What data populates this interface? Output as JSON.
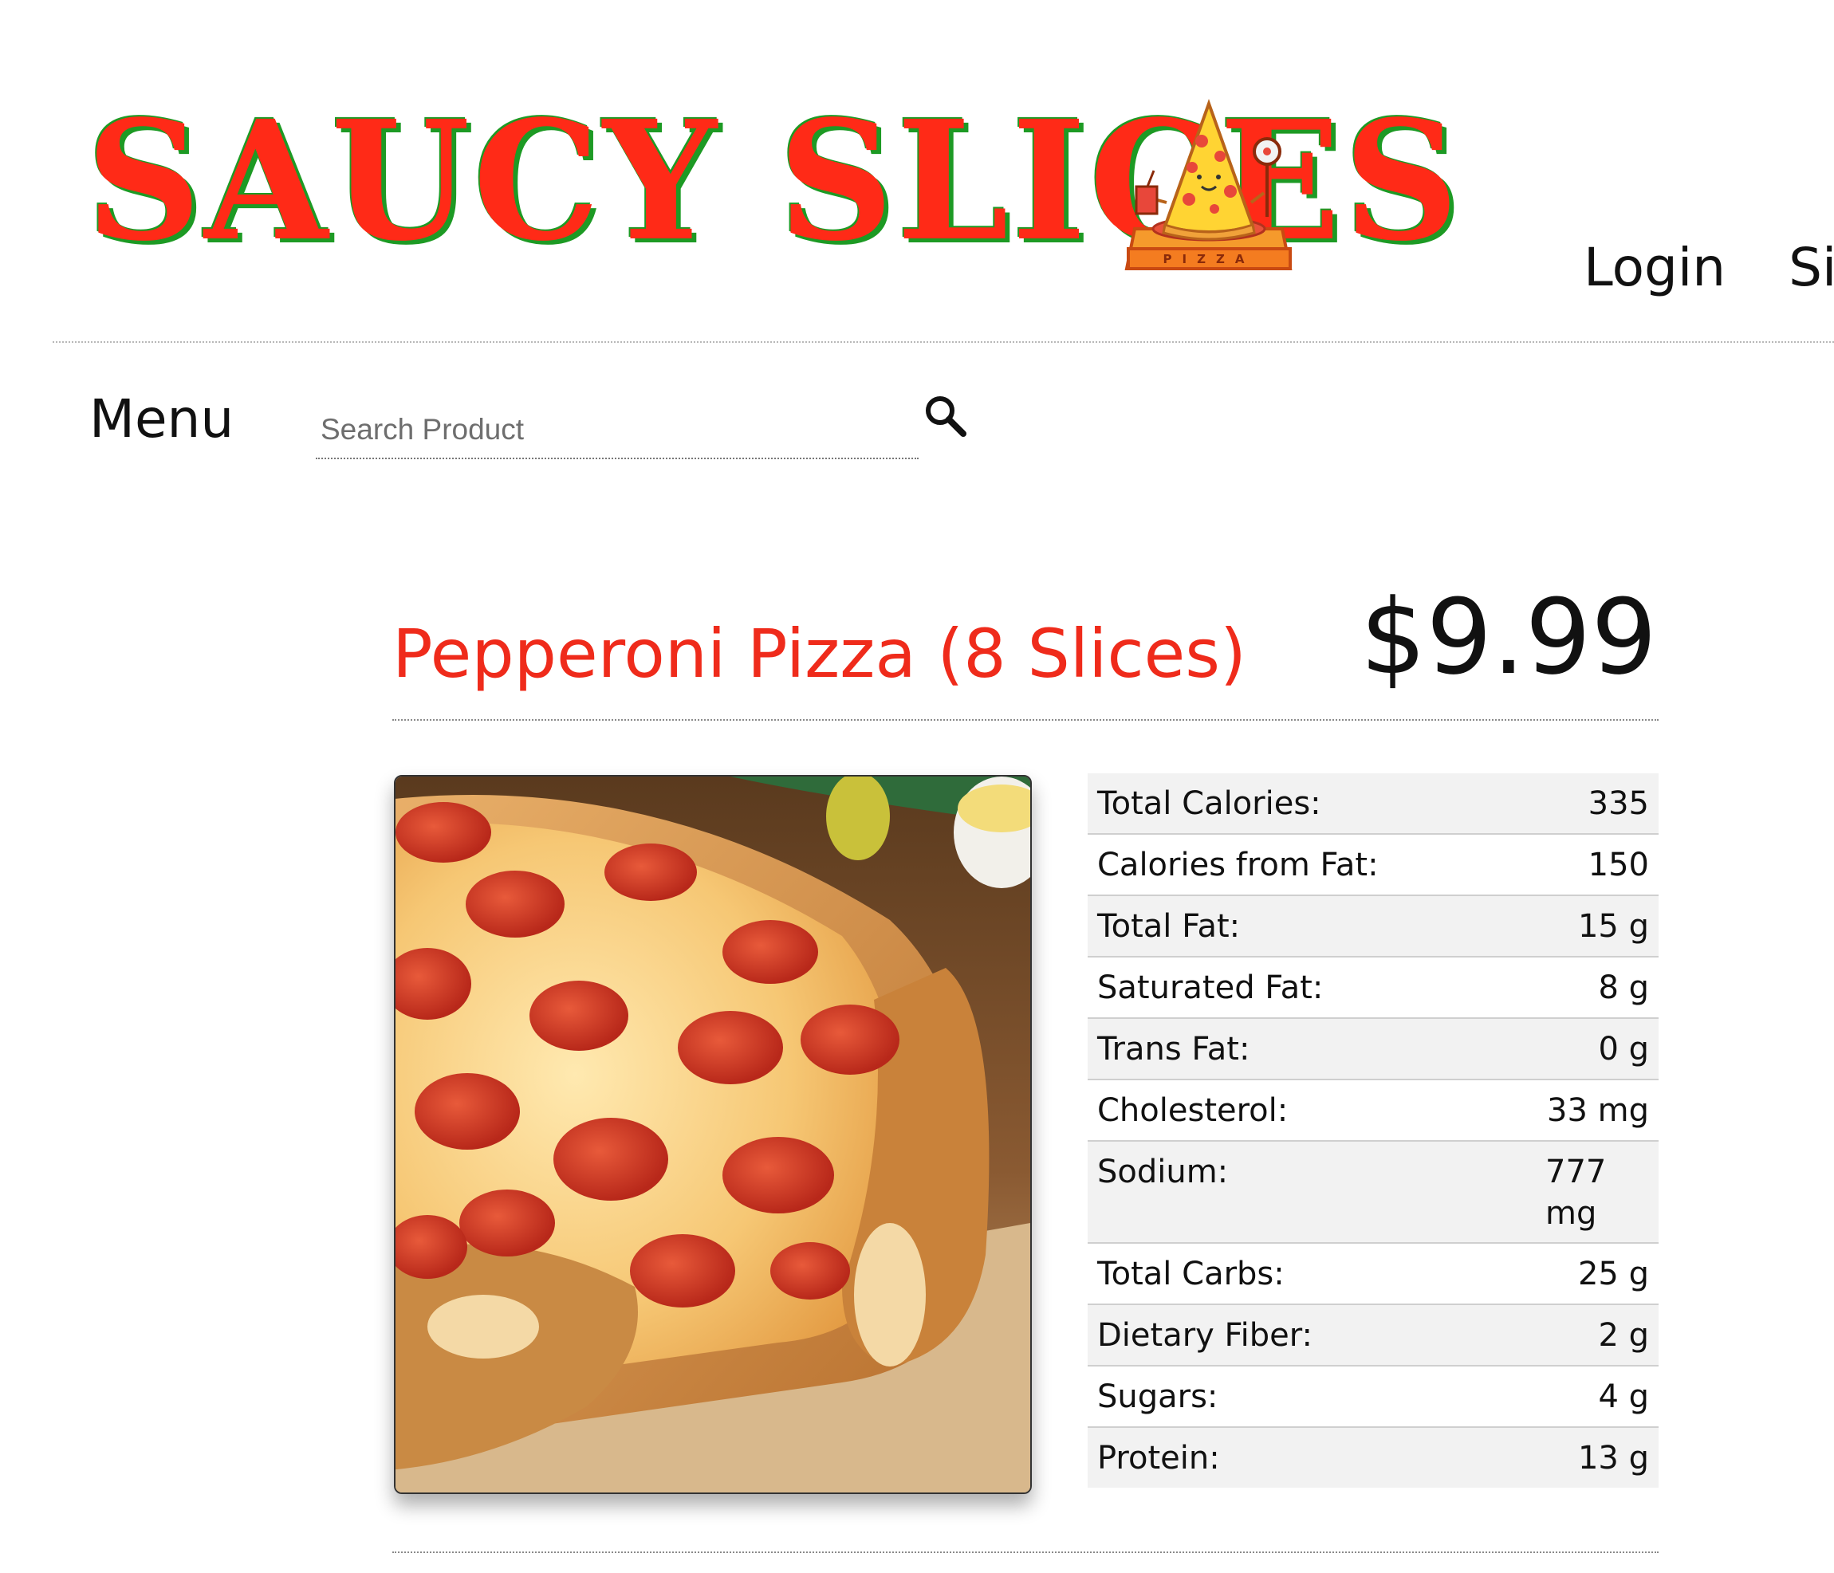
{
  "brand": {
    "logo_text": "SAUCY SLICES",
    "mascot_box_label": "PIZZA",
    "colors": {
      "logo_red": "#ff2a17",
      "logo_green": "#1d9a24",
      "title_red": "#ef2b1b"
    }
  },
  "nav": {
    "login_label": "Login",
    "signup_label": "Sig"
  },
  "menu_bar": {
    "title": "Menu",
    "search_placeholder": "Search Product",
    "search_icon": "search-icon"
  },
  "product": {
    "name": "Pepperoni Pizza (8 Slices)",
    "price": "$9.99",
    "image_subject": "pepperoni-pizza-photo"
  },
  "nutrition": [
    {
      "label": "Total Calories:",
      "value": "335"
    },
    {
      "label": "Calories from Fat:",
      "value": "150"
    },
    {
      "label": "Total Fat:",
      "value": "15 g"
    },
    {
      "label": "Saturated Fat:",
      "value": "8 g"
    },
    {
      "label": "Trans Fat:",
      "value": "0 g"
    },
    {
      "label": "Cholesterol:",
      "value": "33 mg"
    },
    {
      "label": "Sodium:",
      "value": "777 mg"
    },
    {
      "label": "Total Carbs:",
      "value": "25 g"
    },
    {
      "label": "Dietary Fiber:",
      "value": "2 g"
    },
    {
      "label": "Sugars:",
      "value": "4 g"
    },
    {
      "label": "Protein:",
      "value": "13 g"
    }
  ]
}
